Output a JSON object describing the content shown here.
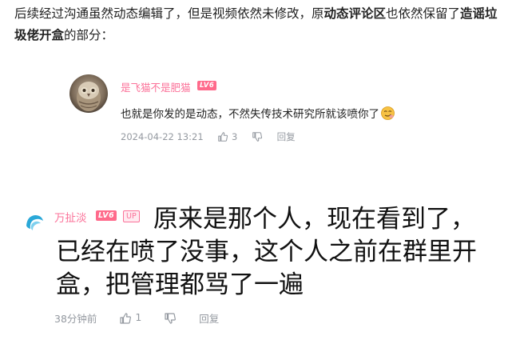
{
  "intro": {
    "part1": "后续经过沟通虽然动态编辑了，但是视频依然未修改，原",
    "bold1": "动态评论区",
    "part2": "也依然保留了",
    "bold2": "造谣垃圾佬开盒",
    "part3": "的部分："
  },
  "comment1": {
    "username": "是飞猫不是肥猫",
    "level": "LV6",
    "text": "也就是你发的是动态，不然失传技术研究所就该喷你了",
    "emoji": "smug-face-emoji",
    "timestamp": "2024-04-22 13:21",
    "likes": "3",
    "reply_label": "回复",
    "name_color": "#fb7299"
  },
  "comment2": {
    "username": "万扯淡",
    "level": "LV6",
    "up_badge": "UP",
    "text": "原来是那个人，现在看到了，已经在喷了没事，这个人之前在群里开盒，把管理都骂了一遍",
    "timestamp": "38分钟前",
    "likes": "1",
    "reply_label": "回复",
    "name_color": "#fb7299"
  },
  "icons": {
    "like": "thumbs-up-icon",
    "dislike": "thumbs-down-icon",
    "avatar2": "wave-logo-avatar"
  }
}
